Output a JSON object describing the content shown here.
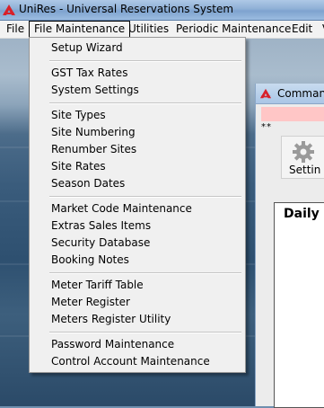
{
  "window": {
    "title": "UniRes - Universal Reservations System"
  },
  "menubar": [
    "File",
    "File Maintenance",
    "Utilities",
    "Periodic Maintenance",
    "Edit",
    "V"
  ],
  "dropdown": {
    "groups": [
      [
        "Setup Wizard"
      ],
      [
        "GST Tax Rates",
        "System Settings"
      ],
      [
        "Site Types",
        "Site Numbering",
        "Renumber Sites",
        "Site Rates",
        "Season Dates"
      ],
      [
        "Market Code Maintenance",
        "Extras Sales Items",
        "Security Database",
        "Booking Notes"
      ],
      [
        "Meter Tariff Table",
        "Meter Register",
        "Meters Register Utility"
      ],
      [
        "Password Maintenance",
        "Control Account Maintenance"
      ]
    ]
  },
  "command_window": {
    "title": "Command",
    "stars": "**",
    "setting_label": "Settin",
    "daily_label": "Daily F"
  },
  "icons": {
    "app": "unires-logo-icon",
    "command": "unires-logo-icon",
    "setting": "gear-icon"
  },
  "colors": {
    "pink_bar": "#ffc6c6",
    "logo_red": "#d8202a"
  }
}
